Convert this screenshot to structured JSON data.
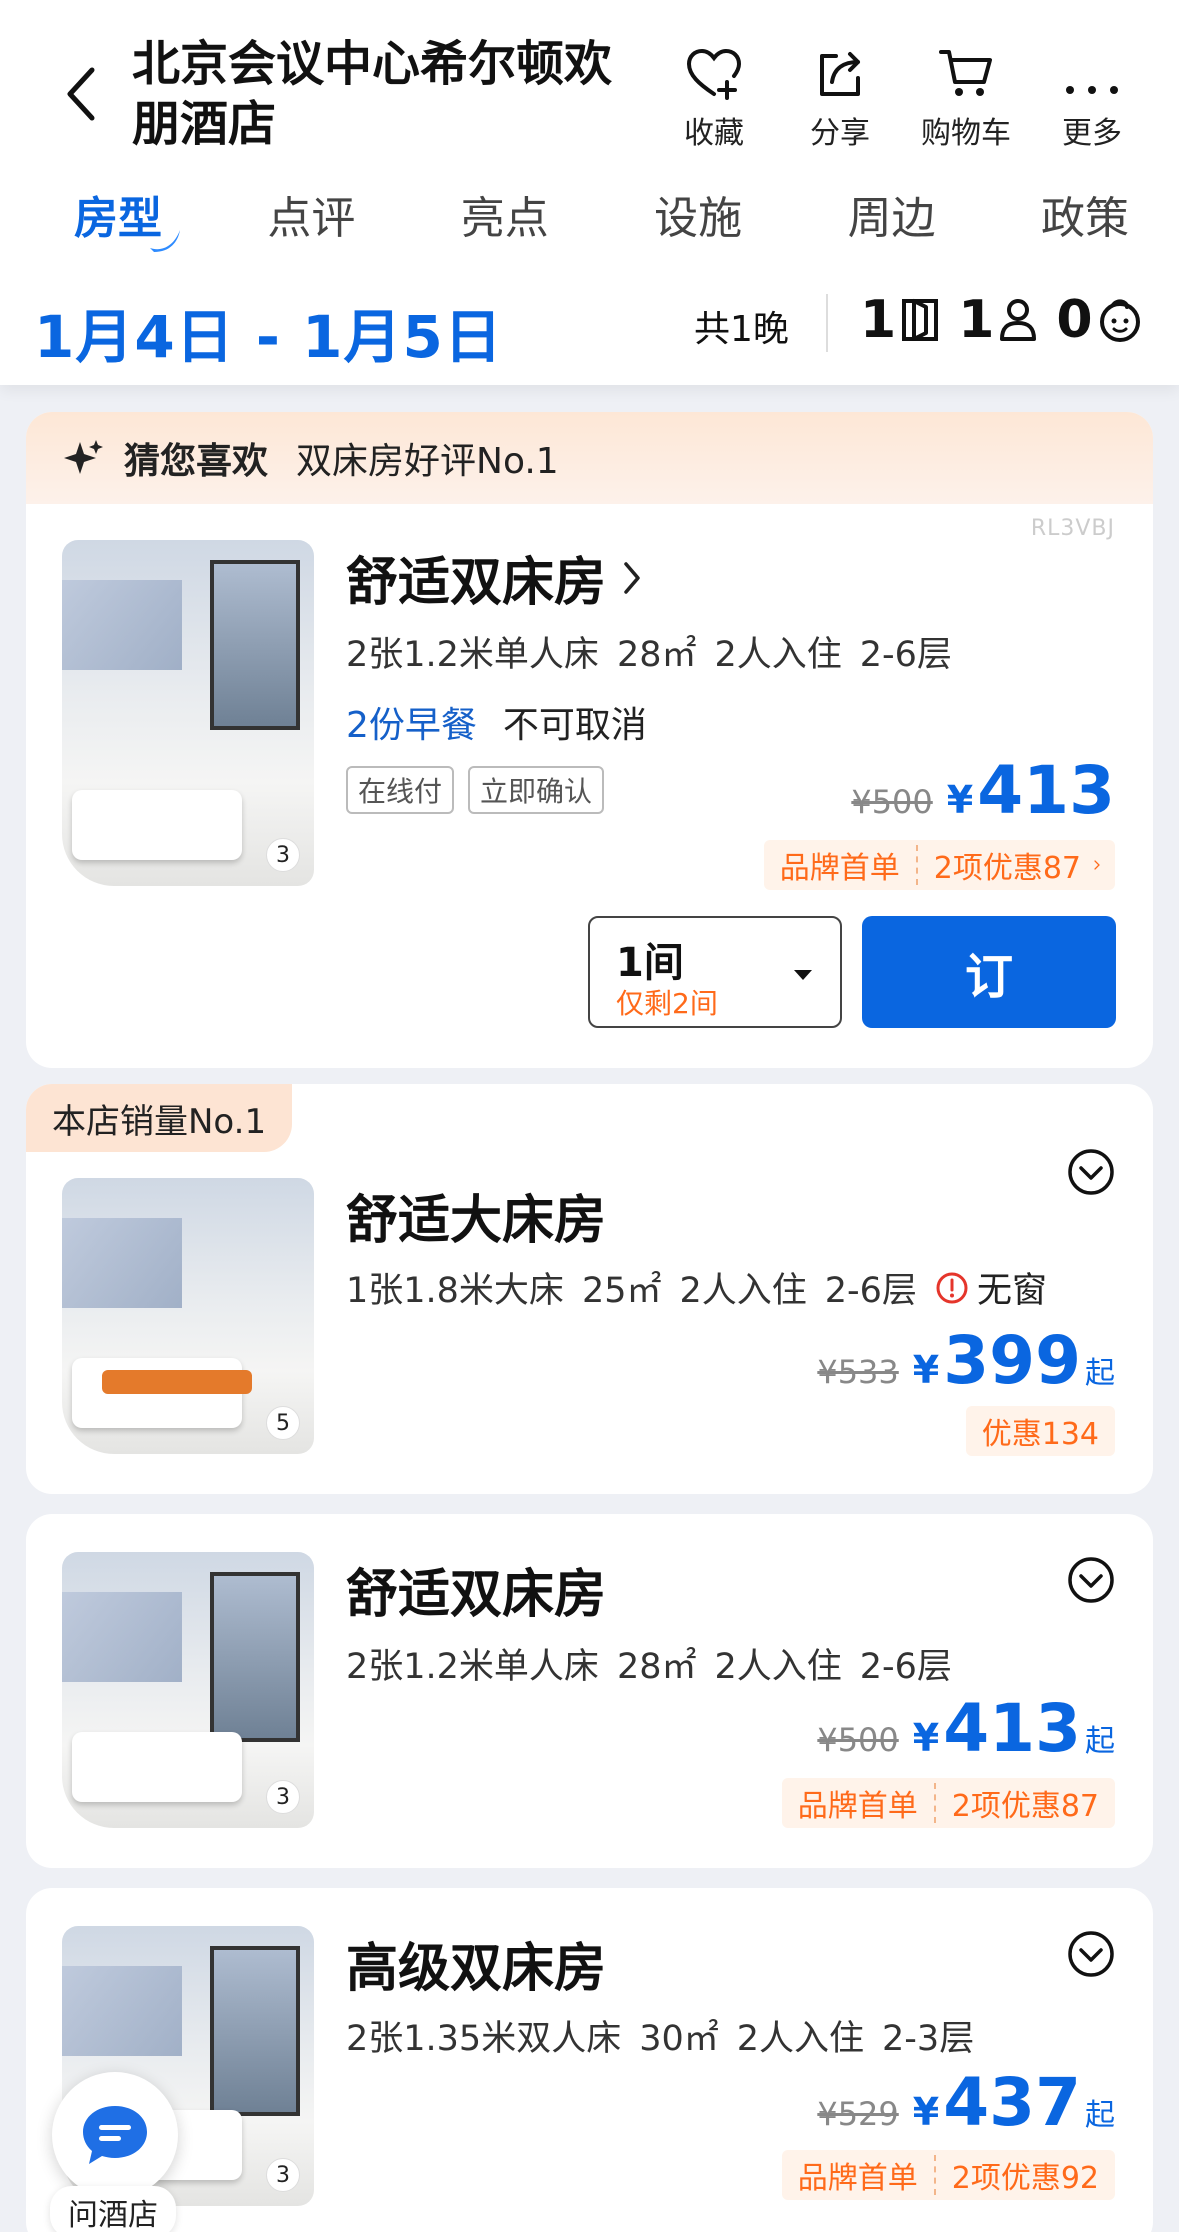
{
  "header": {
    "title": "北京会议中心希尔顿欢朋酒店",
    "actions": [
      {
        "label": "收藏",
        "icon": "heart-plus-icon"
      },
      {
        "label": "分享",
        "icon": "share-icon"
      },
      {
        "label": "购物车",
        "icon": "cart-icon"
      },
      {
        "label": "更多",
        "icon": "more-icon"
      }
    ]
  },
  "tabs": [
    "房型",
    "点评",
    "亮点",
    "设施",
    "周边",
    "政策"
  ],
  "active_tab": "房型",
  "date_bar": {
    "dates": "1月4日 - 1月5日",
    "nights": "共1晚",
    "rooms": "1",
    "adults": "1",
    "children": "0"
  },
  "recommend": {
    "label": "猜您喜欢",
    "reason": "双床房好评No.1",
    "code": "RL3VBJ",
    "room": {
      "name": "舒适双床房",
      "photo_count": "3",
      "info": [
        "2张1.2米单人床",
        "28㎡",
        "2人入住",
        "2-6层"
      ],
      "breakfast": "2份早餐",
      "cancel": "不可取消",
      "tags": [
        "在线付",
        "立即确认"
      ],
      "orig_price": "¥500",
      "currency": "¥",
      "price": "413",
      "promo_brand": "品牌首单",
      "promo_discount": "2项优惠87",
      "qty": "1间",
      "qty_left": "仅剩2间",
      "book_label": "订"
    }
  },
  "rooms": [
    {
      "badge": "本店销量No.1",
      "name": "舒适大床房",
      "photo_count": "5",
      "info": [
        "1张1.8米大床",
        "25㎡",
        "2人入住",
        "2-6层"
      ],
      "warning": "无窗",
      "orig_price": "¥533",
      "currency": "¥",
      "price": "399",
      "suffix": "起",
      "promo_discount": "优惠134"
    },
    {
      "name": "舒适双床房",
      "photo_count": "3",
      "info": [
        "2张1.2米单人床",
        "28㎡",
        "2人入住",
        "2-6层"
      ],
      "orig_price": "¥500",
      "currency": "¥",
      "price": "413",
      "suffix": "起",
      "promo_brand": "品牌首单",
      "promo_discount": "2项优惠87"
    },
    {
      "name": "高级双床房",
      "photo_count": "3",
      "info": [
        "2张1.35米双人床",
        "30㎡",
        "2人入住",
        "2-3层"
      ],
      "orig_price": "¥529",
      "currency": "¥",
      "price": "437",
      "suffix": "起",
      "promo_brand": "品牌首单",
      "promo_discount": "2项优惠92"
    }
  ],
  "chat": {
    "label": "问酒店"
  },
  "colors": {
    "accent": "#0a66e0",
    "promo": "#ff6a1a",
    "badge_bg": "#fde4d3"
  }
}
